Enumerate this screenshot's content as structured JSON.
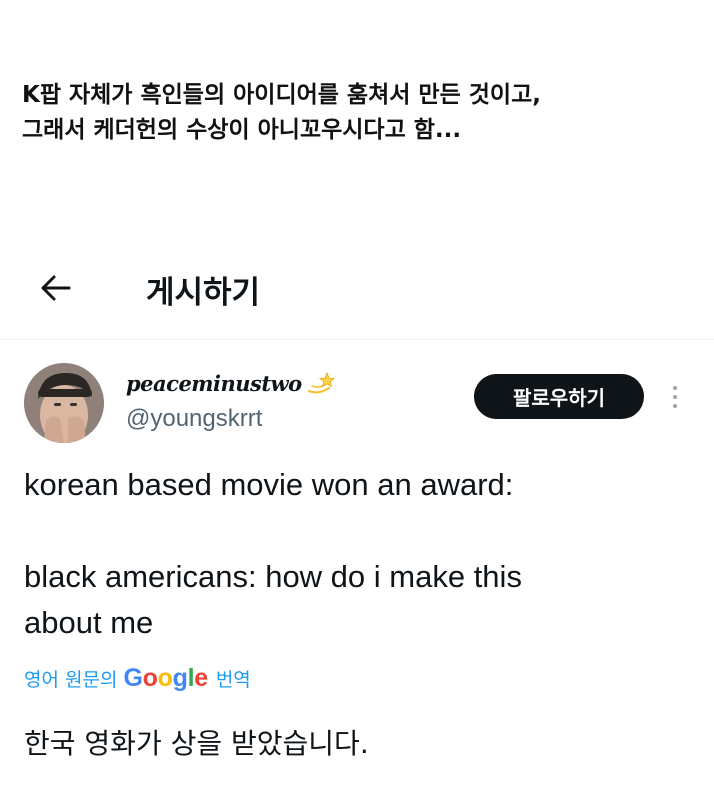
{
  "caption": {
    "line1": "K팝 자체가 흑인들의 아이디어를 훔쳐서 만든 것이고,",
    "line2": "그래서 케더헌의 수상이 아니꼬우시다고 함..."
  },
  "header": {
    "back_icon": "arrow-left-icon",
    "title": "게시하기"
  },
  "tweet": {
    "display_name": "peaceminustwo",
    "name_emoji_icon": "dizzy-star-icon",
    "handle": "@youngskrrt",
    "follow_label": "팔로우하기",
    "more_icon": "vertical-dots-icon",
    "text_line1": "korean based movie won an award:",
    "text_line2": "black americans: how do i make this",
    "text_line3": "about me",
    "translate": {
      "prefix": "영어 원문의",
      "brand": "Google",
      "suffix": "번역"
    },
    "translated_text": "한국 영화가 상을 받았습니다."
  },
  "colors": {
    "text": "#0f1419",
    "secondary": "#536471",
    "link": "#1d9bf0",
    "follow_bg": "#0f1419",
    "google_blue": "#4285f4",
    "google_red": "#ea4335",
    "google_yellow": "#fbbc05",
    "google_green": "#34a853"
  }
}
